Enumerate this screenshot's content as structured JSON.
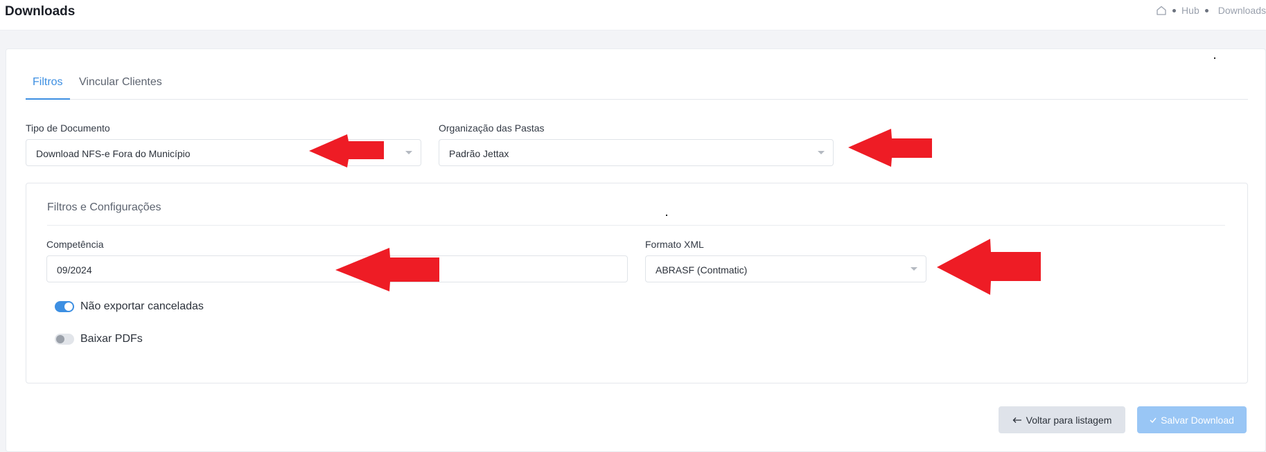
{
  "header": {
    "title": "Downloads",
    "breadcrumb": {
      "hub": "Hub",
      "current": "Downloads"
    }
  },
  "tabs": [
    {
      "label": "Filtros",
      "active": true
    },
    {
      "label": "Vincular Clientes",
      "active": false
    }
  ],
  "form": {
    "tipo_documento": {
      "label": "Tipo de Documento",
      "value": "Download NFS-e Fora do Município"
    },
    "organizacao_pastas": {
      "label": "Organização das Pastas",
      "value": "Padrão Jettax"
    }
  },
  "section": {
    "title": "Filtros e Configurações",
    "competencia": {
      "label": "Competência",
      "value": "09/2024"
    },
    "formato_xml": {
      "label": "Formato XML",
      "value": "ABRASF (Contmatic)"
    },
    "toggles": [
      {
        "label": "Não exportar canceladas",
        "checked": true
      },
      {
        "label": "Baixar PDFs",
        "checked": false
      }
    ]
  },
  "buttons": {
    "back_label": "Voltar para listagem",
    "save_label": "Salvar Download"
  },
  "icons": {
    "home": "home-icon",
    "back": "arrow-left-icon",
    "save": "check-icon",
    "annotation": "red-arrow-icon"
  },
  "colors": {
    "accent": "#3d8fe2",
    "annotation_red": "#ee1c25",
    "save_button": "#99c6f5"
  }
}
